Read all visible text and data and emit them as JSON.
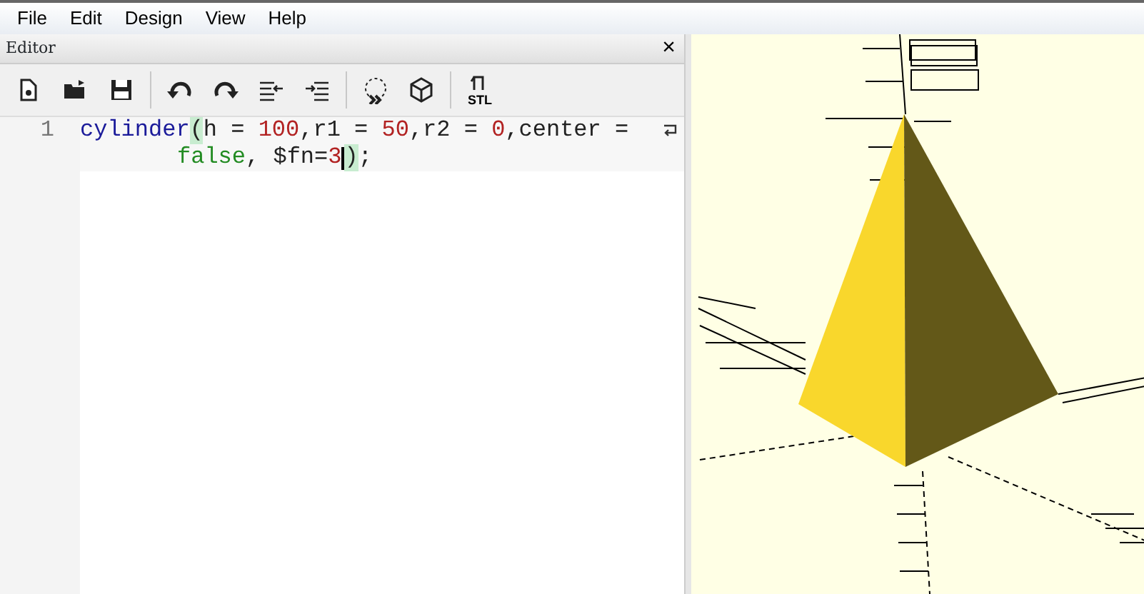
{
  "menu": [
    "File",
    "Edit",
    "Design",
    "View",
    "Help"
  ],
  "editor": {
    "title": "Editor",
    "close": "×",
    "toolbar": [
      [
        {
          "kind": "new"
        },
        {
          "kind": "open"
        },
        {
          "kind": "save"
        }
      ],
      [
        {
          "kind": "undo"
        },
        {
          "kind": "redo"
        },
        {
          "kind": "unindent"
        },
        {
          "kind": "indent"
        }
      ],
      [
        {
          "kind": "preview"
        },
        {
          "kind": "render"
        }
      ],
      [
        {
          "kind": "export",
          "label": "STL"
        }
      ]
    ],
    "lines": [
      {
        "number": "1",
        "segments": [
          {
            "tokens": [
              {
                "text": "cylinder",
                "kind": "keyword"
              },
              {
                "text": "(",
                "kind": "bracket_match"
              },
              {
                "text": "h = ",
                "kind": "plain"
              },
              {
                "text": "100",
                "kind": "number"
              },
              {
                "text": ",r1 = ",
                "kind": "plain"
              },
              {
                "text": "50",
                "kind": "number"
              },
              {
                "text": ",r2 = ",
                "kind": "plain"
              },
              {
                "text": "0",
                "kind": "number"
              },
              {
                "text": ",center = ",
                "kind": "plain"
              }
            ]
          },
          {
            "tokens": [
              {
                "text": "false",
                "kind": "literal"
              },
              {
                "text": ", $fn=",
                "kind": "plain"
              },
              {
                "text": "3",
                "kind": "number",
                "cursor_after": true
              },
              {
                "text": ")",
                "kind": "bracket_match"
              },
              {
                "text": ";",
                "kind": "plain"
              }
            ]
          }
        ]
      }
    ]
  }
}
